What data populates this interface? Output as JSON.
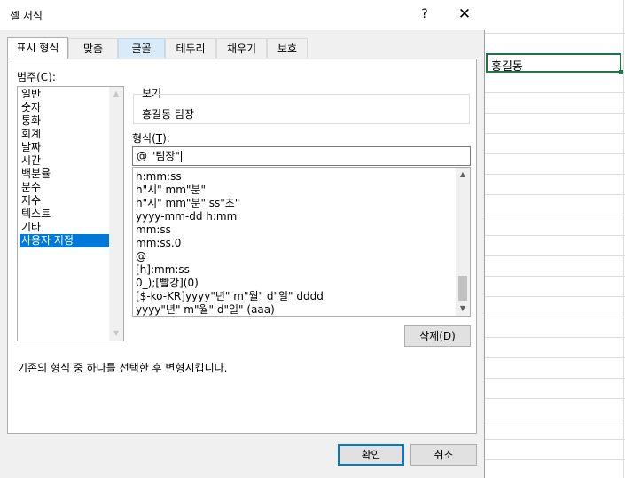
{
  "dialog": {
    "title": "셀 서식",
    "help_label": "?",
    "close_label": "✕"
  },
  "tabs": [
    {
      "label": "표시 형식"
    },
    {
      "label": "맞춤"
    },
    {
      "label": "글꼴"
    },
    {
      "label": "테두리"
    },
    {
      "label": "채우기"
    },
    {
      "label": "보호"
    }
  ],
  "category": {
    "label_prefix": "범주(",
    "label_key": "C",
    "label_suffix": "):",
    "items": [
      "일반",
      "숫자",
      "통화",
      "회계",
      "날짜",
      "시간",
      "백분율",
      "분수",
      "지수",
      "텍스트",
      "기타",
      "사용자 지정"
    ],
    "selected": "사용자 지정"
  },
  "preview": {
    "legend": "보기",
    "value": "홍길동 팀장"
  },
  "format": {
    "label_prefix": "형식(",
    "label_key": "T",
    "label_suffix": "):",
    "input_value": "@ \"팀장\"",
    "items": [
      "h:mm:ss",
      "h\"시\" mm\"분\"",
      "h\"시\" mm\"분\" ss\"초\"",
      "yyyy-mm-dd h:mm",
      "mm:ss",
      "mm:ss.0",
      "@",
      "[h]:mm:ss",
      "0_);[빨강](0)",
      "[$-ko-KR]yyyy\"년\" m\"월\" d\"일\" dddd",
      "yyyy\"년\" m\"월\" d\"일\" (aaa)"
    ]
  },
  "delete_button": {
    "label_prefix": "삭제(",
    "label_key": "D",
    "label_suffix": ")"
  },
  "description": "기존의 형식 중 하나를 선택한 후 변형시킵니다.",
  "ok_label": "확인",
  "cancel_label": "취소",
  "sheet": {
    "active_cell_value": "홍길동"
  }
}
